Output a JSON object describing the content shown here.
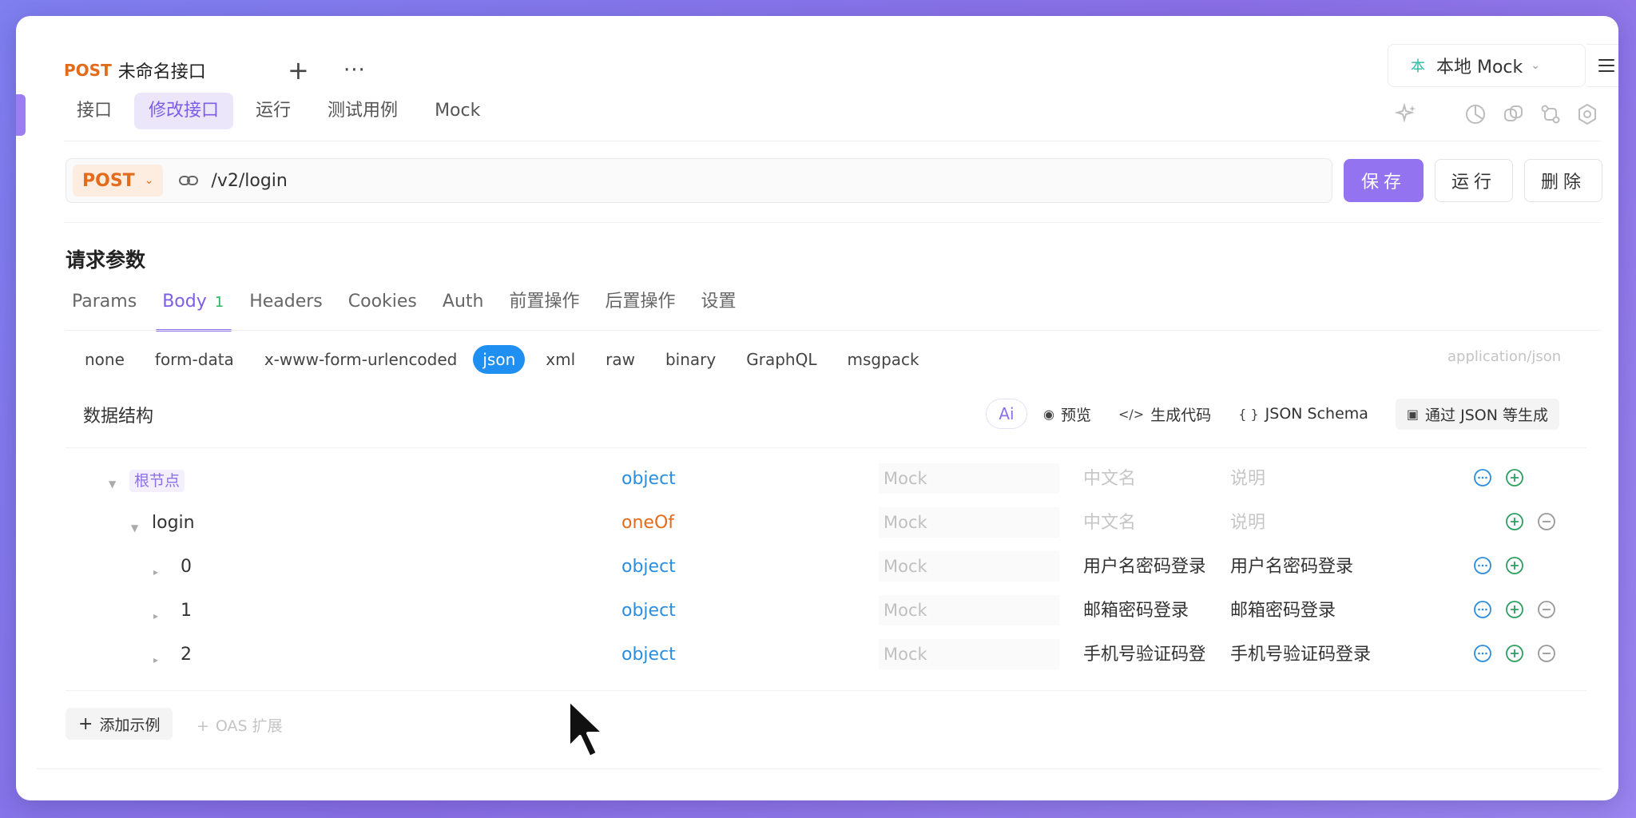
{
  "header": {
    "method": "POST",
    "api_name": "未命名接口",
    "add_tab": "+",
    "more": "···",
    "env_badge": "本",
    "env_label": "本地 Mock"
  },
  "nav": {
    "tabs": [
      {
        "label": "接口"
      },
      {
        "label": "修改接口"
      },
      {
        "label": "运行"
      },
      {
        "label": "测试用例"
      },
      {
        "label": "Mock"
      }
    ]
  },
  "request": {
    "method": "POST",
    "url": "/v2/login",
    "save_label": "保存",
    "run_label": "运行",
    "delete_label": "删除"
  },
  "params": {
    "section_title": "请求参数",
    "tabs": [
      {
        "label": "Params"
      },
      {
        "label": "Body",
        "count": "1"
      },
      {
        "label": "Headers"
      },
      {
        "label": "Cookies"
      },
      {
        "label": "Auth"
      },
      {
        "label": "前置操作"
      },
      {
        "label": "后置操作"
      },
      {
        "label": "设置"
      }
    ],
    "body_types": [
      "none",
      "form-data",
      "x-www-form-urlencoded",
      "json",
      "xml",
      "raw",
      "binary",
      "GraphQL",
      "msgpack"
    ],
    "content_type": "application/json"
  },
  "schema": {
    "title": "数据结构",
    "ai_label": "Ai",
    "preview_label": "预览",
    "gen_code_label": "生成代码",
    "json_schema_label": "JSON Schema",
    "gen_from_json_label": "通过 JSON 等生成",
    "rows": [
      {
        "key": "根节点",
        "type": "object",
        "mock": "Mock",
        "cn_name": "中文名",
        "desc": "说明"
      },
      {
        "key": "login",
        "type": "oneOf",
        "mock": "Mock",
        "cn_name": "中文名",
        "desc": "说明"
      },
      {
        "key": "0",
        "type": "object",
        "mock": "Mock",
        "cn_name": "用户名密码登录",
        "desc": "用户名密码登录"
      },
      {
        "key": "1",
        "type": "object",
        "mock": "Mock",
        "cn_name": "邮箱密码登录",
        "desc": "邮箱密码登录"
      },
      {
        "key": "2",
        "type": "object",
        "mock": "Mock",
        "cn_name": "手机号验证码登录",
        "desc": "手机号验证码登录"
      }
    ],
    "add_example_label": "添加示例",
    "oas_ext_label": "OAS 扩展"
  },
  "colors": {
    "accent": "#9373ef",
    "method": "#e36b1b",
    "type_object": "#2b8de0",
    "type_oneof": "#e36b1b",
    "add_green": "#2f9e63"
  }
}
